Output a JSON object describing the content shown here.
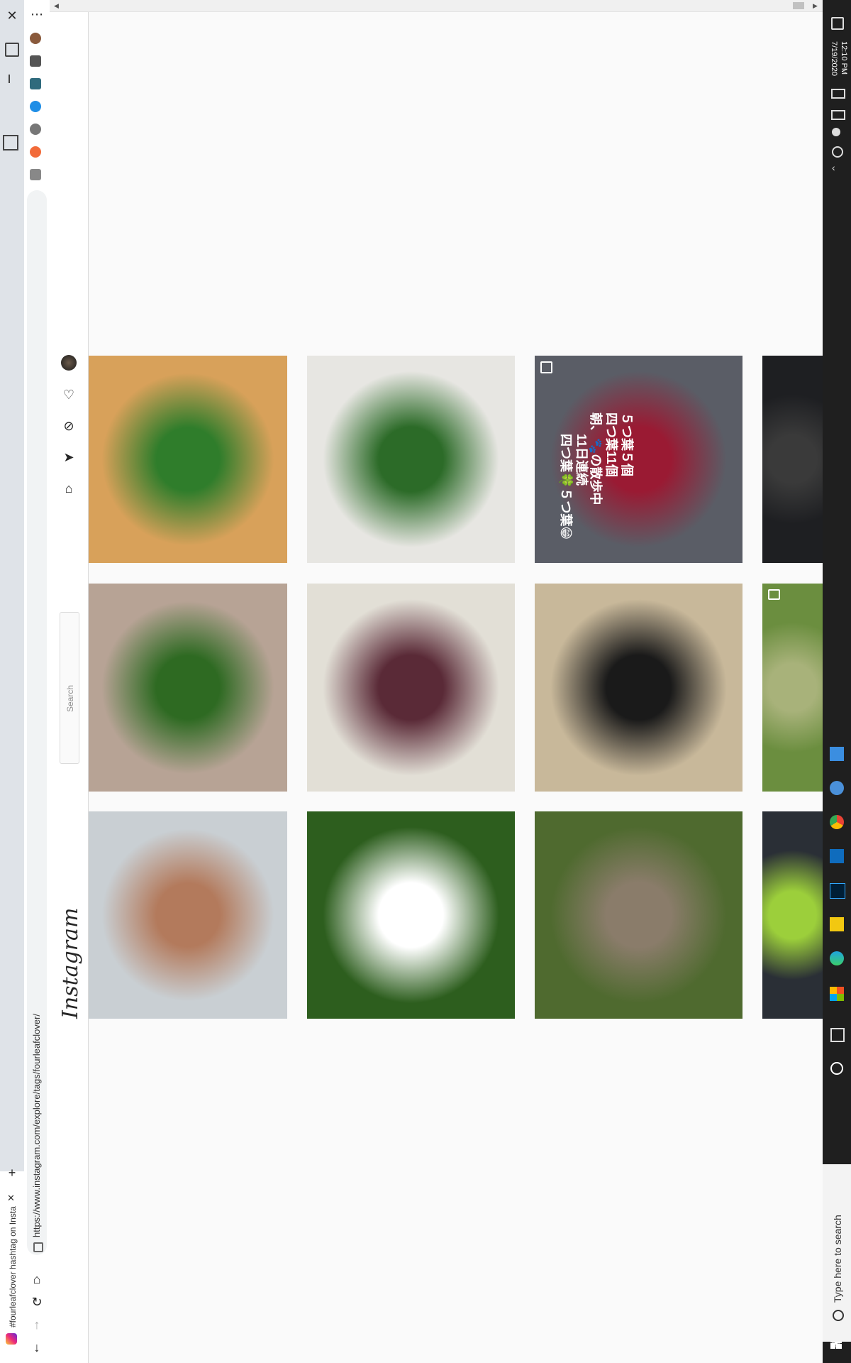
{
  "browser": {
    "tab_title": "#fourleafclover hashtag on Insta",
    "url": "https://www.instagram.com/explore/tags/fourleafclover/",
    "buttons": {
      "close": "✕",
      "menu": "⋯",
      "new_tab": "+",
      "download": "↓"
    }
  },
  "instagram": {
    "logo": "Instagram",
    "search_placeholder": "Search"
  },
  "posts": [
    {
      "id": "p1",
      "colors": [
        "#d8a15a",
        "#2f7d2b"
      ]
    },
    {
      "id": "p2",
      "colors": [
        "#e7e6e2",
        "#2c6b28"
      ]
    },
    {
      "id": "p3",
      "colors": [
        "#5a5d66",
        "#9a1a33"
      ],
      "overlay": [
        "11日連続",
        "四つ葉🍀５つ葉😁",
        "朝、🐾の散歩中",
        "四つ葉11個",
        "５つ葉５個"
      ]
    },
    {
      "id": "p4",
      "colors": [
        "#1e1f22",
        "#3a3a3a"
      ]
    },
    {
      "id": "p5",
      "colors": [
        "#b7a395",
        "#2e6a22"
      ]
    },
    {
      "id": "p6",
      "colors": [
        "#e2dfd6",
        "#5a2a37"
      ]
    },
    {
      "id": "p7",
      "colors": [
        "#c8b89a",
        "#1a1a1a"
      ]
    },
    {
      "id": "p8",
      "colors": [
        "#6b8e3f",
        "#a8b27a"
      ]
    },
    {
      "id": "p9",
      "colors": [
        "#c9cfd3",
        "#b37a5c"
      ]
    },
    {
      "id": "p10",
      "colors": [
        "#2d5e1e",
        "#ffffff"
      ]
    },
    {
      "id": "p11",
      "colors": [
        "#4f6a2f",
        "#8a7c6a"
      ]
    },
    {
      "id": "p12",
      "colors": [
        "#2a2f36",
        "#9ccf3b"
      ]
    }
  ],
  "system": {
    "time": "12:10 PM",
    "date": "7/19/2020",
    "search_placeholder": "Type here to search"
  }
}
